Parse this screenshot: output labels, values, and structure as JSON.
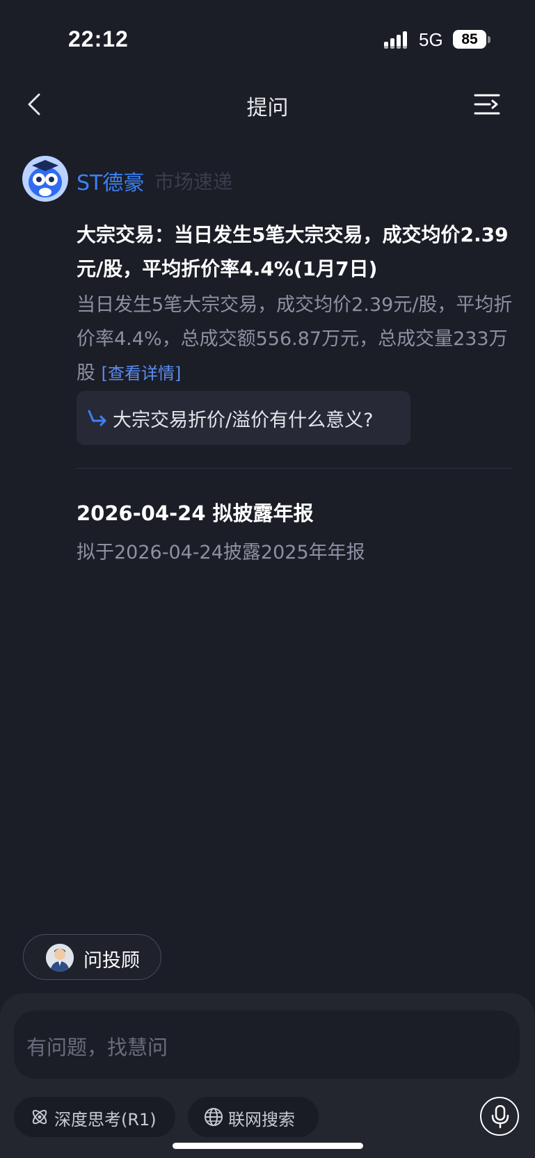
{
  "status_bar": {
    "time": "22:12",
    "network": "5G",
    "battery": "85"
  },
  "nav": {
    "title": "提问",
    "back_icon": "chevron-left-icon",
    "menu_icon": "menu-lines-icon"
  },
  "stock": {
    "name": "ST德豪",
    "subtitle": "市场速递"
  },
  "news": {
    "headline": "大宗交易：当日发生5笔大宗交易，成交均价2.39元/股，平均折价率4.4%(1月7日)",
    "summary": "当日发生5笔大宗交易，成交均价2.39元/股，平均折价率4.4%，总成交额556.87万元，总成交量233万股",
    "detail_link": "[查看详情]",
    "suggestion": "大宗交易折价/溢价有什么意义?"
  },
  "event": {
    "title": "2026-04-24 拟披露年报",
    "desc": "拟于2026-04-24披露2025年年报"
  },
  "advisor": {
    "label": "问投顾"
  },
  "composer": {
    "placeholder": "有问题，找慧问",
    "deep_think_label": "深度思考(R1)",
    "web_search_label": "联网搜索"
  },
  "colors": {
    "background": "#1b1d27",
    "accent_blue": "#3b82f6",
    "secondary_text": "#8d91a2"
  }
}
